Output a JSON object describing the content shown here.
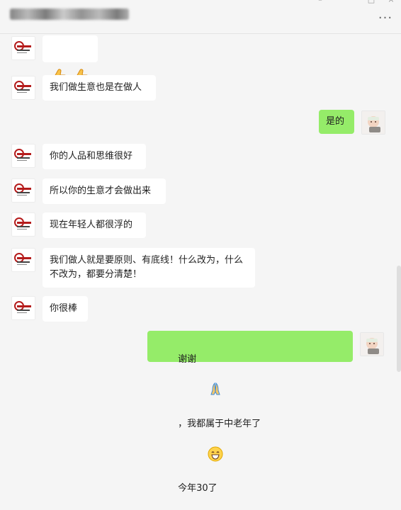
{
  "window": {
    "title_redacted": true,
    "controls": {
      "minimize": "–",
      "maximize": "□",
      "close": "×",
      "more": "..."
    }
  },
  "messages": [
    {
      "side": "left",
      "type": "emoji",
      "content": [
        "thumbs-up",
        "thumbs-up"
      ]
    },
    {
      "side": "left",
      "type": "text",
      "content": "我们做生意也是在做人"
    },
    {
      "side": "right",
      "type": "text",
      "content": "是的"
    },
    {
      "side": "left",
      "type": "text",
      "content": "你的人品和思维很好"
    },
    {
      "side": "left",
      "type": "text",
      "content": "所以你的生意才会做出来"
    },
    {
      "side": "left",
      "type": "text",
      "content": "现在年轻人都很浮的"
    },
    {
      "side": "left",
      "type": "text",
      "content": "我们做人就是要原则、有底线！什么改为，什么不改为，都要分清楚！"
    },
    {
      "side": "left",
      "type": "text",
      "content": "你很棒"
    },
    {
      "side": "right",
      "type": "text",
      "parts": [
        "谢谢",
        "folded-hands",
        "，我都属于中老年了",
        "grinning-face",
        "今年30了"
      ]
    }
  ],
  "colors": {
    "background": "#f5f5f5",
    "bubble_left": "#ffffff",
    "bubble_right": "#95ec69",
    "divider": "#e3e3e3"
  }
}
